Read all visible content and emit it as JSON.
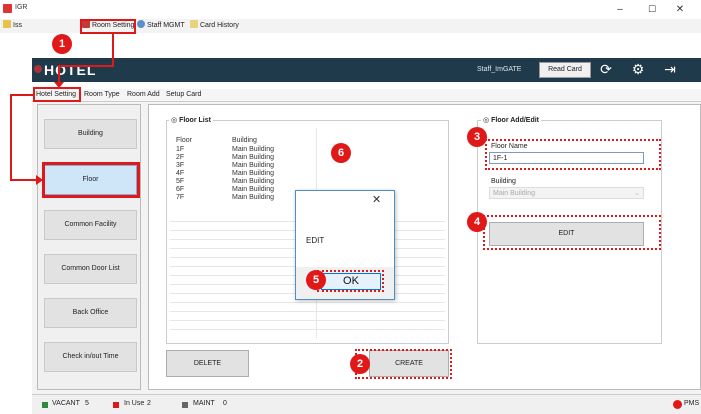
{
  "window": {
    "title": "IGR",
    "controls": {
      "minimize": "–",
      "maximize": "☐",
      "close": "✕"
    }
  },
  "menu": {
    "items": [
      {
        "label": "Iss"
      },
      {
        "label": "Room Setting"
      },
      {
        "label": "Staff MGMT"
      },
      {
        "label": "Card History"
      }
    ]
  },
  "header": {
    "logo": "HOTEL",
    "user": "Staff_ImGATE",
    "read_card": "Read Card"
  },
  "tabs": [
    "Hotel Setting",
    "Room Type",
    "Room Add",
    "Setup Card"
  ],
  "sidebar": {
    "items": [
      {
        "label": "Building"
      },
      {
        "label": "Floor"
      },
      {
        "label": "Common Facility"
      },
      {
        "label": "Common Door List"
      },
      {
        "label": "Back Office"
      },
      {
        "label": "Check in/out Time"
      }
    ]
  },
  "floor_list": {
    "title": "Floor List",
    "columns": [
      "Floor",
      "Building"
    ],
    "rows": [
      [
        "1F",
        "Main Building"
      ],
      [
        "2F",
        "Main Building"
      ],
      [
        "3F",
        "Main Building"
      ],
      [
        "4F",
        "Main Building"
      ],
      [
        "5F",
        "Main Building"
      ],
      [
        "6F",
        "Main Building"
      ],
      [
        "7F",
        "Main Building"
      ]
    ],
    "delete": "DELETE",
    "create": "CREATE"
  },
  "add_edit": {
    "title": "Floor Add/Edit",
    "floor_name_label": "Floor Name",
    "floor_name_value": "1F-1",
    "building_label": "Building",
    "building_value": "Main Building",
    "edit": "EDIT"
  },
  "dialog": {
    "message": "EDIT",
    "ok": "OK",
    "close": "✕"
  },
  "annotations": [
    "1",
    "2",
    "3",
    "4",
    "5",
    "6"
  ],
  "status": {
    "vacant_label": "VACANT",
    "vacant_count": "5",
    "inuse_label": "In Use",
    "inuse_count": "2",
    "maint_label": "MAINT",
    "maint_count": "0",
    "pms": "PMS"
  },
  "colors": {
    "accent_red": "#e01818",
    "header_bg": "#1f3a4a",
    "active_side": "#cfe6f8"
  }
}
